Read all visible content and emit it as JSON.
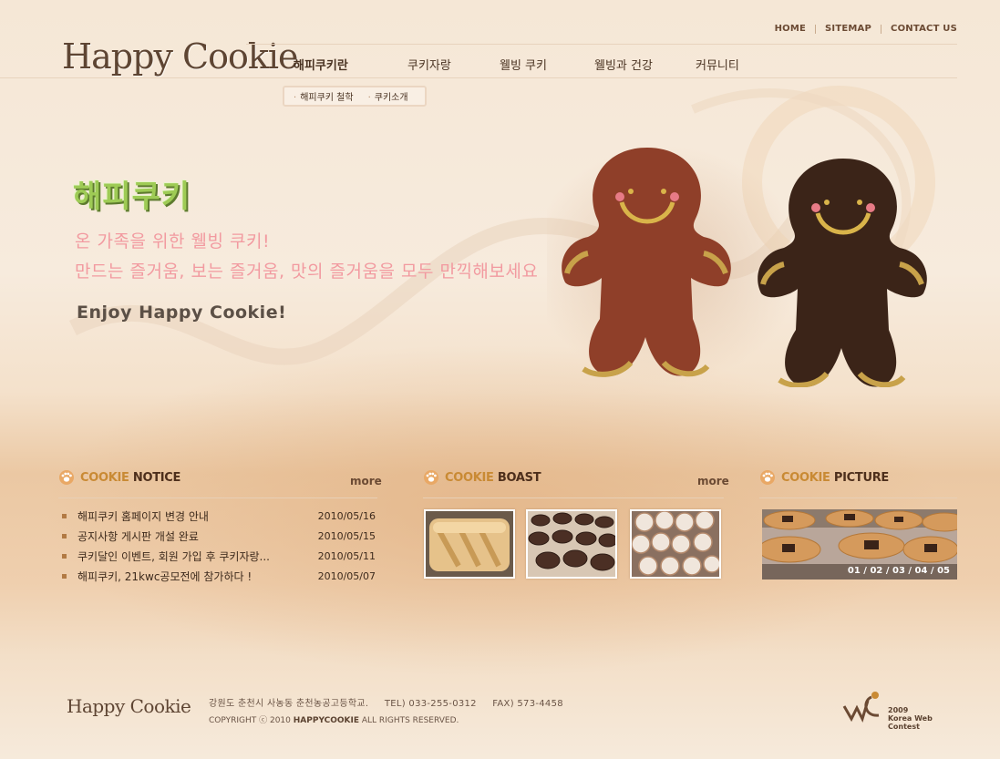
{
  "brand": {
    "logo": "Happy Cookie"
  },
  "util_nav": [
    "HOME",
    "SITEMAP",
    "CONTACT US"
  ],
  "gnb": [
    {
      "label": "해피쿠키란"
    },
    {
      "label": "쿠키자랑"
    },
    {
      "label": "웰빙 쿠키"
    },
    {
      "label": "웰빙과 건강"
    },
    {
      "label": "커뮤니티"
    }
  ],
  "subnav": [
    "해피쿠키 철학",
    "쿠키소개"
  ],
  "hero": {
    "title": "해피쿠키",
    "line1": "온 가족을 위한 웰빙 쿠키!",
    "line2": "만드는 즐거움, 보는 즐거움, 맛의 즐거움을 모두 만끽해보세요",
    "tagline": "Enjoy Happy Cookie!"
  },
  "notice": {
    "title_accent": "COOKIE",
    "title_rest": "NOTICE",
    "more": "more",
    "items": [
      {
        "text": "해피쿠키 홈페이지 변경 안내",
        "date": "2010/05/16"
      },
      {
        "text": "공지사항 게시판 개설 완료",
        "date": "2010/05/15"
      },
      {
        "text": "쿠키달인 이벤트, 회원 가입 후 쿠키자랑...",
        "date": "2010/05/11"
      },
      {
        "text": "해피쿠키, 21kwc공모전에 참가하다 !",
        "date": "2010/05/07"
      }
    ]
  },
  "boast": {
    "title_accent": "COOKIE",
    "title_rest": "BOAST",
    "more": "more"
  },
  "picture": {
    "title_accent": "COOKIE",
    "title_rest": "PICTURE",
    "pages": [
      "01",
      "02",
      "03",
      "04",
      "05"
    ]
  },
  "footer": {
    "logo": "Happy Cookie",
    "address": "강원도 춘천시 사농동 춘천농공고등학교.",
    "tel": "TEL) 033-255-0312",
    "fax": "FAX) 573-4458",
    "copy_prefix": "COPYRIGHT ⓒ 2010",
    "copy_brand": "HAPPYCOOKIE",
    "copy_suffix": "ALL RIGHTS RESERVED.",
    "badge_year": "2009",
    "badge_text": "Korea Web Contest"
  },
  "colors": {
    "accent_orange": "#c98a34",
    "hero_green": "#9ecb55",
    "hero_pink": "#f29aa0",
    "text_brown": "#4e2f1c"
  }
}
